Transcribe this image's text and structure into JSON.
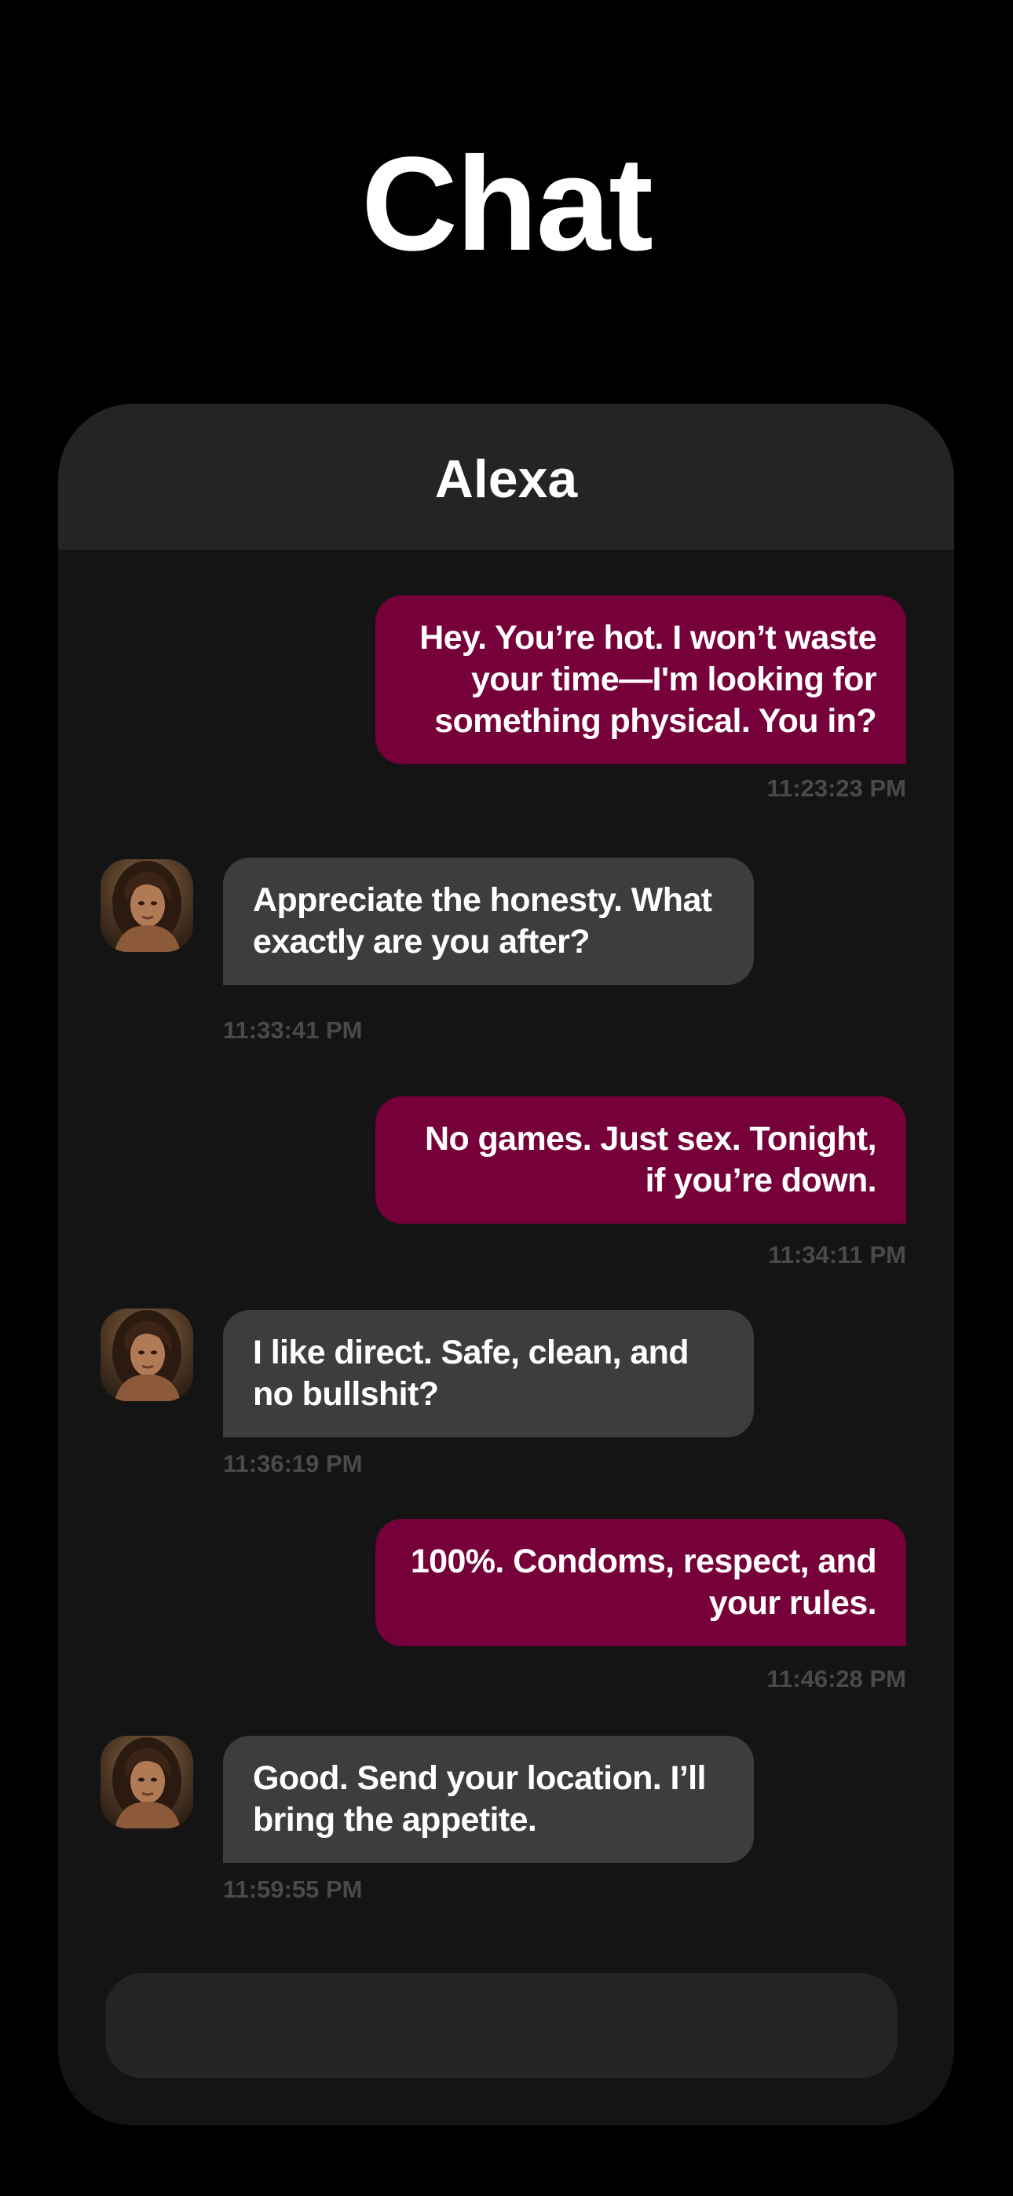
{
  "page": {
    "title": "Chat"
  },
  "chat": {
    "contact_name": "Alexa",
    "composer_placeholder": "",
    "colors": {
      "outgoing_bubble": "#76003a",
      "incoming_bubble": "#3d3d3d",
      "timestamp": "#4a4a4a",
      "card_background": "#141414",
      "header_background": "#242424"
    },
    "messages": [
      {
        "direction": "outgoing",
        "text": "Hey. You’re hot. I won’t waste your time—I'm looking for something physical. You in?",
        "time": "11:23:23 PM"
      },
      {
        "direction": "incoming",
        "text": "Appreciate the honesty. What exactly are you after?",
        "time": "11:33:41 PM",
        "avatar": "contact-avatar"
      },
      {
        "direction": "outgoing",
        "text": "No games. Just sex. Tonight, if you’re down.",
        "time": "11:34:11 PM"
      },
      {
        "direction": "incoming",
        "text": "I like direct. Safe, clean, and no bullshit?",
        "time": "11:36:19 PM",
        "avatar": "contact-avatar"
      },
      {
        "direction": "outgoing",
        "text": "100%. Condoms, respect, and your rules.",
        "time": "11:46:28 PM"
      },
      {
        "direction": "incoming",
        "text": "Good. Send your location. I’ll bring the appetite.",
        "time": "11:59:55 PM",
        "avatar": "contact-avatar"
      }
    ]
  }
}
